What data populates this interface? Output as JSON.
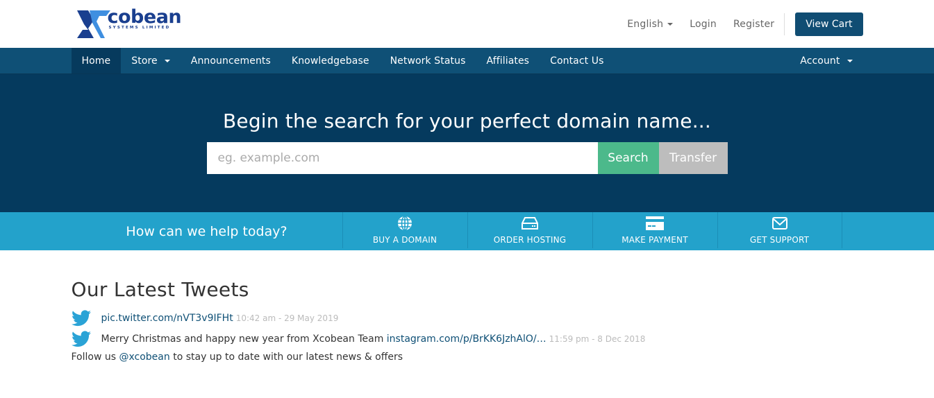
{
  "brand": {
    "name": "cobean",
    "subtitle": "SYSTEMS LIMITED",
    "primary_color": "#104d73",
    "hero_color": "#053a5e",
    "help_color": "#23a2cb",
    "search_color": "#4cb98b",
    "transfer_color": "#bdbdbd"
  },
  "top_nav": {
    "language": "English",
    "login": "Login",
    "register": "Register",
    "view_cart": "View Cart"
  },
  "main_nav": {
    "items": [
      {
        "label": "Home",
        "active": true
      },
      {
        "label": "Store",
        "dropdown": true
      },
      {
        "label": "Announcements"
      },
      {
        "label": "Knowledgebase"
      },
      {
        "label": "Network Status"
      },
      {
        "label": "Affiliates"
      },
      {
        "label": "Contact Us"
      }
    ],
    "account": "Account"
  },
  "hero": {
    "title": "Begin the search for your perfect domain name...",
    "search_placeholder": "eg. example.com",
    "search_value": "",
    "search_button": "Search",
    "transfer_button": "Transfer"
  },
  "help_bar": {
    "title": "How can we help today?",
    "items": [
      {
        "label": "BUY A DOMAIN",
        "icon": "globe-icon"
      },
      {
        "label": "ORDER HOSTING",
        "icon": "hdd-icon"
      },
      {
        "label": "MAKE PAYMENT",
        "icon": "credit-card-icon"
      },
      {
        "label": "GET SUPPORT",
        "icon": "envelope-icon"
      }
    ]
  },
  "tweets": {
    "heading": "Our Latest Tweets",
    "items": [
      {
        "text": "",
        "link": "pic.twitter.com/nVT3v9IFHt",
        "date": "10:42 am - 29 May 2019"
      },
      {
        "text": "Merry Christmas and happy new year from Xcobean Team ",
        "link": "instagram.com/p/BrKK6JzhAlO/…",
        "date": "11:59 pm - 8 Dec 2018"
      }
    ],
    "follow_prefix": "Follow us ",
    "follow_handle": "@xcobean",
    "follow_suffix": " to stay up to date with our latest news & offers"
  }
}
